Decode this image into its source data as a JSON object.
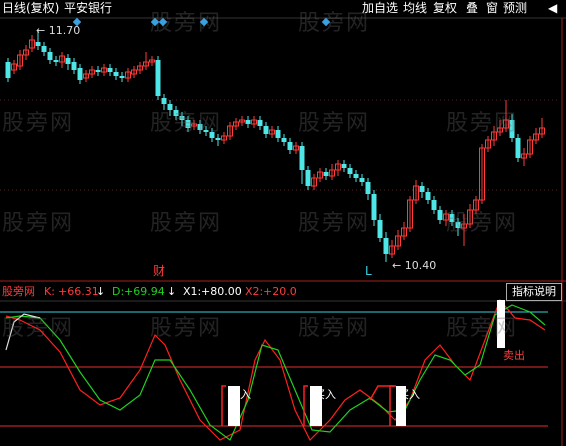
{
  "toolbar": {
    "period": "日线(复权)",
    "stock_name": "平安银行",
    "buttons": [
      "加自选",
      "均线",
      "复权",
      "叠",
      "窗",
      "预测"
    ],
    "back_arrow": "◀"
  },
  "watermark": "股旁网",
  "price_labels": {
    "high": "11.70",
    "low": "10.40"
  },
  "markers": {
    "cai": "财",
    "L": "L"
  },
  "indicator": {
    "name": "股旁网",
    "k_label": "K:",
    "k_value": "+66.31",
    "d_label": "D:",
    "d_value": "+69.94",
    "x1_label": "X1:",
    "x1_value": "+80.00",
    "x2_label": "X2:",
    "x2_value": "+20.0",
    "explain_button": "指标说明",
    "buy_label": "买入",
    "sell_label": "卖出"
  },
  "colors": {
    "up": "#ff3b3b",
    "down": "#4ee6e6",
    "k_line": "#ffffff",
    "d_line": "#ffd23a",
    "indicator_red": "#ff2020",
    "indicator_green": "#20d020",
    "ref_line": "#e03030",
    "ref_line_cyan": "#3ad0e0",
    "diamond": "#3aa0e0"
  },
  "icons": {
    "down_arrow": "down-arrow-icon"
  },
  "chart_data": {
    "type": "candlestick",
    "high_value": 11.7,
    "low_value": 10.4,
    "indicator_values": {
      "K": 66.31,
      "D": 69.94,
      "X1": 80.0,
      "X2": 20.0
    }
  }
}
